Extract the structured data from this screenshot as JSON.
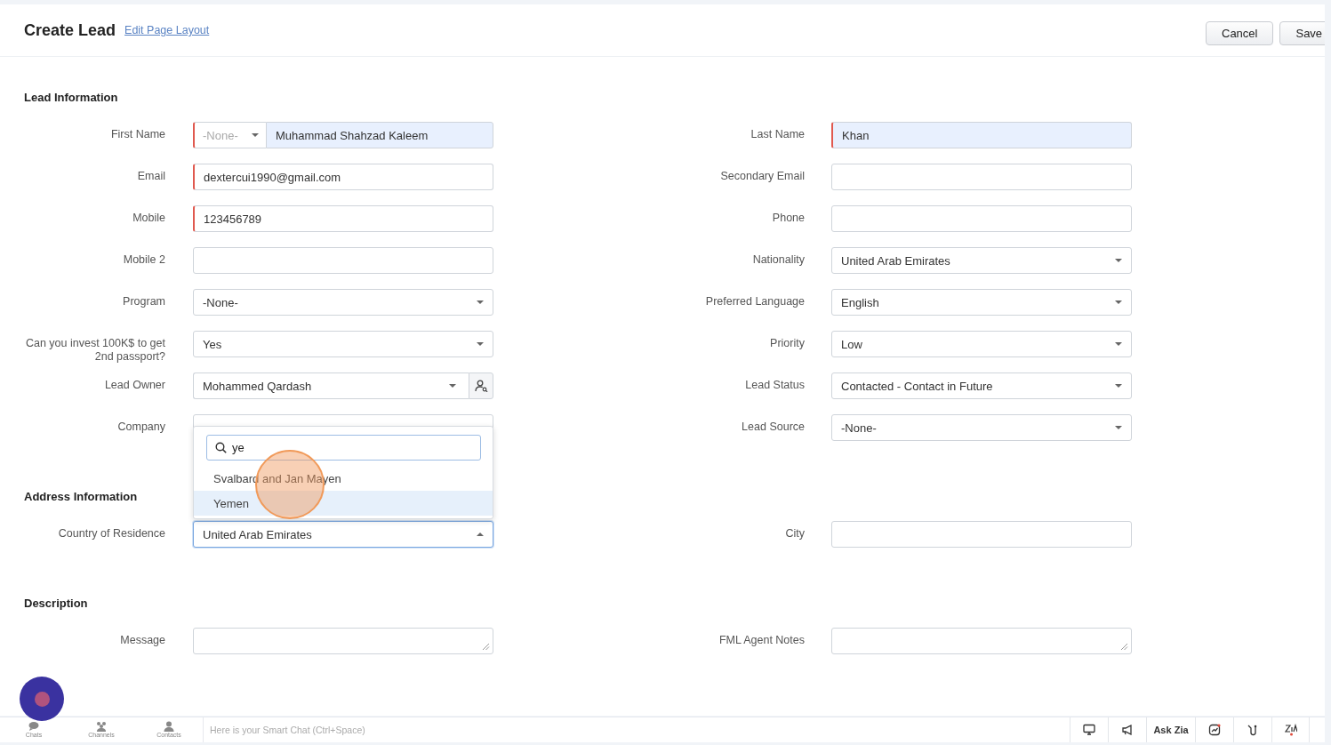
{
  "header": {
    "title": "Create Lead",
    "link": "Edit Page Layout",
    "buttons": [
      {
        "label": "Cancel"
      },
      {
        "label": "Save"
      }
    ]
  },
  "sections": [
    {
      "title": "Lead Information",
      "rows": [
        {
          "left": {
            "label": "First Name",
            "kind": "name",
            "salutation": "-None-",
            "value": "Muhammad Shahzad Kaleem",
            "required": true,
            "autofilled": true
          },
          "right": {
            "label": "Last Name",
            "kind": "text",
            "value": "Khan",
            "required": true,
            "autofilled": true
          }
        },
        {
          "left": {
            "label": "Email",
            "kind": "text",
            "value": "dextercui1990@gmail.com",
            "required": true,
            "autofilled": false
          },
          "right": {
            "label": "Secondary Email",
            "kind": "text",
            "required": false,
            "autofilled": false
          }
        },
        {
          "left": {
            "label": "Mobile",
            "kind": "text",
            "value": "123456789",
            "required": true,
            "autofilled": false
          },
          "right": {
            "label": "Phone",
            "kind": "text",
            "required": false,
            "autofilled": false
          }
        },
        {
          "left": {
            "label": "Mobile 2",
            "kind": "text",
            "required": false,
            "autofilled": false
          },
          "right": {
            "label": "Nationality",
            "kind": "select",
            "value": "United Arab Emirates",
            "open": false
          }
        },
        {
          "left": {
            "label": "Program",
            "kind": "select",
            "value": "-None-",
            "open": false
          },
          "right": {
            "label": "Preferred Language",
            "kind": "select",
            "value": "English",
            "open": false
          }
        },
        {
          "left": {
            "label": "Can you invest 100K$ to get 2nd passport?",
            "kind": "select",
            "value": "Yes",
            "open": false
          },
          "right": {
            "label": "Priority",
            "kind": "select",
            "value": "Low",
            "open": false
          }
        },
        {
          "left": {
            "label": "Lead Owner",
            "kind": "lookup",
            "value": "Mohammed Qardash"
          },
          "right": {
            "label": "Lead Status",
            "kind": "select",
            "value": "Contacted - Contact in Future",
            "open": false
          }
        },
        {
          "left": {
            "label": "Company",
            "kind": "text",
            "required": false,
            "autofilled": false
          },
          "right": {
            "label": "Lead Source",
            "kind": "select",
            "value": "-None-",
            "open": false
          }
        }
      ]
    },
    {
      "title": "Address Information",
      "rows": [
        {
          "left": {
            "label": "Country of Residence",
            "kind": "select",
            "value": "United Arab Emirates",
            "open": true,
            "dropdown": {
              "search": "ye",
              "options": [
                {
                  "label": "Svalbard and Jan Mayen",
                  "selected": false
                },
                {
                  "label": "Yemen",
                  "selected": true
                }
              ]
            }
          },
          "right": {
            "label": "City",
            "kind": "text",
            "required": false,
            "autofilled": false
          }
        }
      ]
    },
    {
      "title": "Description",
      "rows": [
        {
          "left": {
            "label": "Message",
            "kind": "textarea"
          },
          "right": {
            "label": "FML Agent Notes",
            "kind": "textarea"
          }
        }
      ]
    }
  ],
  "chat_bar": {
    "tabs": [
      {
        "label": "Chats",
        "kind": "chats"
      },
      {
        "label": "Channels",
        "kind": "channels"
      },
      {
        "label": "Contacts",
        "kind": "contacts"
      }
    ],
    "placeholder": "Here is your Smart Chat (Ctrl+Space)",
    "tools": [
      {
        "kind": "monitor"
      },
      {
        "kind": "megaphone"
      },
      {
        "kind": "text",
        "label": "Ask Zia"
      },
      {
        "kind": "chart"
      },
      {
        "kind": "hook"
      },
      {
        "kind": "zia"
      }
    ]
  }
}
